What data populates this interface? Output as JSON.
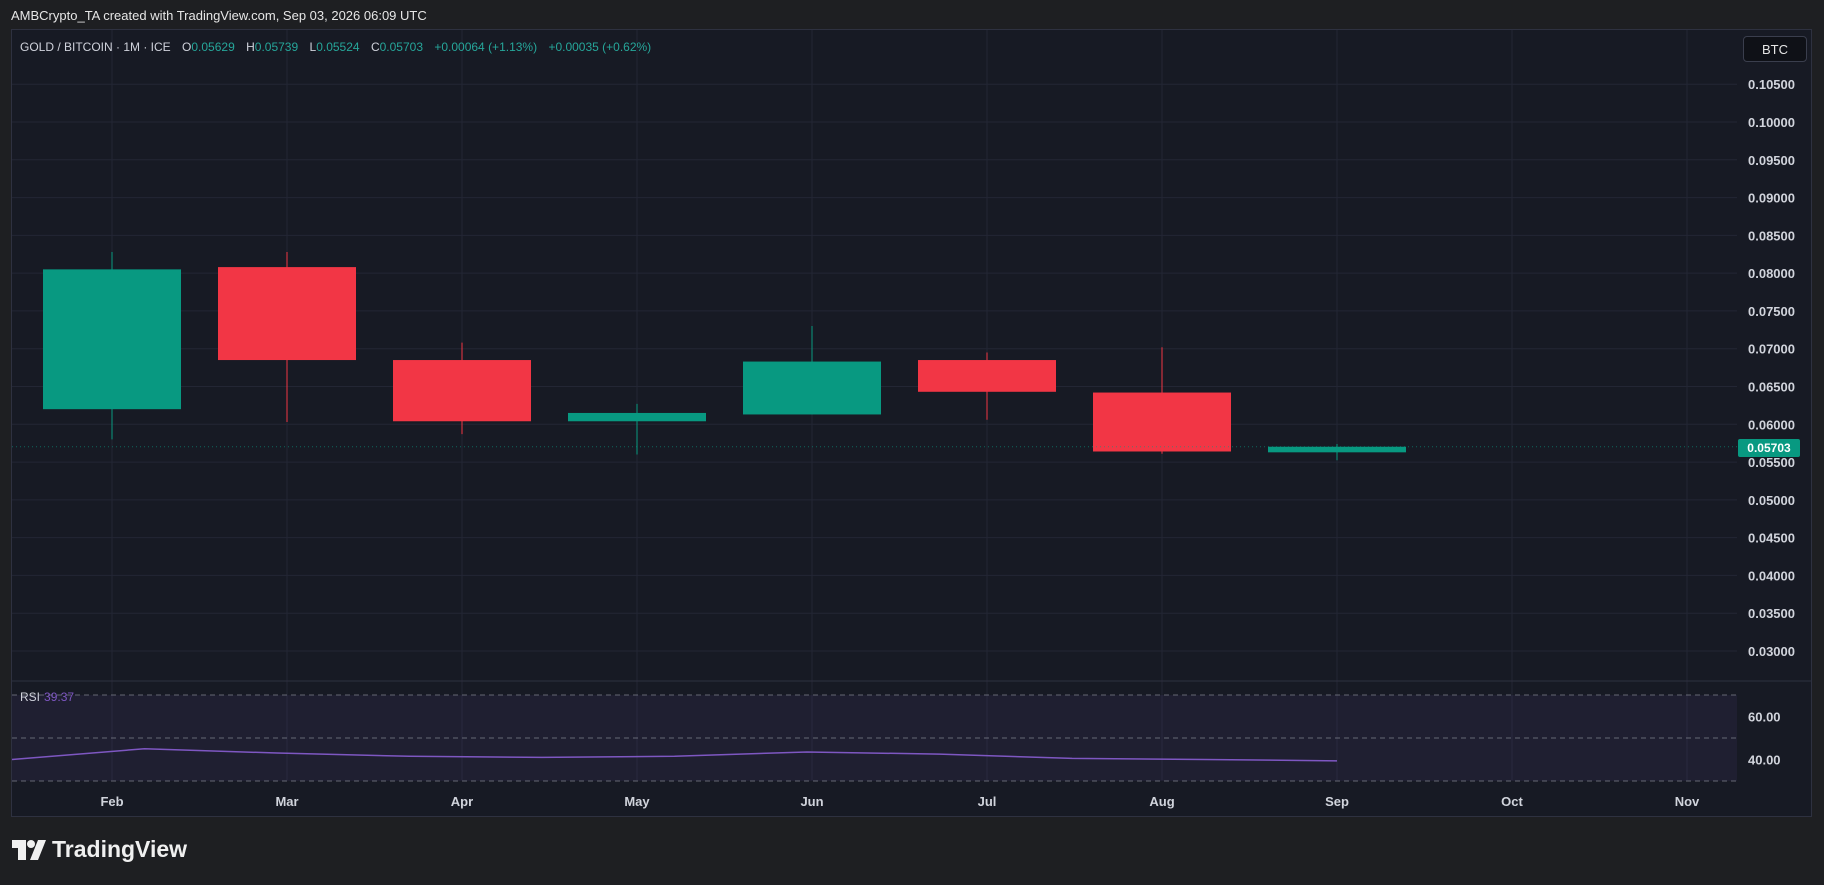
{
  "header": {
    "attribution": "AMBCrypto_TA created with TradingView.com, Sep 03, 2026 06:09 UTC"
  },
  "legend": {
    "symbol": "GOLD / BITCOIN · 1M · ICE",
    "open_label": "O",
    "open": "0.05629",
    "high_label": "H",
    "high": "0.05739",
    "low_label": "L",
    "low": "0.05524",
    "close_label": "C",
    "close": "0.05703",
    "change": "+0.00064 (+1.13%)",
    "change2": "+0.00035 (+0.62%)"
  },
  "currency_badge": "BTC",
  "last_price_tag": "0.05703",
  "rsi": {
    "label": "RSI",
    "value": "39.37"
  },
  "branding": {
    "name": "TradingView"
  },
  "colors": {
    "up": "#089981",
    "down": "#f23645",
    "rsi_line": "#7e57c2",
    "background": "#171a24",
    "grid": "#232634"
  },
  "chart_data": {
    "type": "candlestick",
    "title": "GOLD / BITCOIN · 1M · ICE",
    "x_axis_labels": [
      "Feb",
      "Mar",
      "Apr",
      "May",
      "Jun",
      "Jul",
      "Aug",
      "Sep",
      "Oct",
      "Nov"
    ],
    "y_ticks": [
      "0.10500",
      "0.10000",
      "0.09500",
      "0.09000",
      "0.08500",
      "0.08000",
      "0.07500",
      "0.07000",
      "0.06500",
      "0.06000",
      "0.05500",
      "0.05000",
      "0.04500",
      "0.04000",
      "0.03500",
      "0.03000"
    ],
    "ylim": [
      0.026,
      0.107
    ],
    "candles": [
      {
        "month": "Feb",
        "open": 0.062,
        "high": 0.0828,
        "low": 0.058,
        "close": 0.0805
      },
      {
        "month": "Mar",
        "open": 0.0808,
        "high": 0.0828,
        "low": 0.0603,
        "close": 0.0685
      },
      {
        "month": "Apr",
        "open": 0.0685,
        "high": 0.0708,
        "low": 0.0587,
        "close": 0.0604
      },
      {
        "month": "May",
        "open": 0.0604,
        "high": 0.0627,
        "low": 0.056,
        "close": 0.0615
      },
      {
        "month": "Jun",
        "open": 0.0613,
        "high": 0.073,
        "low": 0.0613,
        "close": 0.0683
      },
      {
        "month": "Jul",
        "open": 0.0685,
        "high": 0.0695,
        "low": 0.0606,
        "close": 0.0643
      },
      {
        "month": "Aug",
        "open": 0.0642,
        "high": 0.0702,
        "low": 0.0561,
        "close": 0.0564
      },
      {
        "month": "Sep",
        "open": 0.05629,
        "high": 0.05739,
        "low": 0.05524,
        "close": 0.05703
      }
    ],
    "rsi": {
      "y_ticks": [
        "60.00",
        "40.00"
      ],
      "ylim": [
        30,
        70
      ],
      "upper_band": 70,
      "mid_band": 50,
      "lower_band": 30,
      "values": [
        40,
        45,
        43,
        41.5,
        41,
        41.5,
        43.5,
        42.5,
        40.5,
        40,
        39.37
      ]
    },
    "last_price": 0.05703
  }
}
